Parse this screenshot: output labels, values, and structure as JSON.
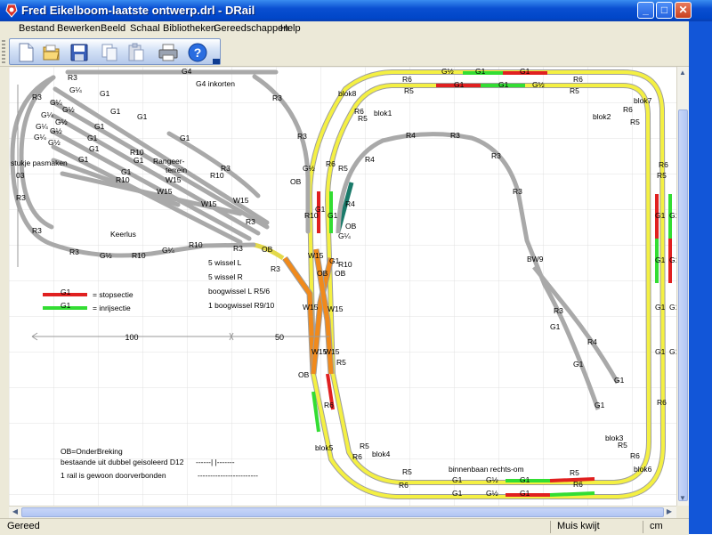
{
  "window": {
    "title": "Fred Eikelboom-laatste ontwerp.drl - DRail",
    "minimize": "_",
    "maximize": "□",
    "close": "✕"
  },
  "menu": [
    "Bestand",
    "Bewerken",
    "Beeld",
    "Schaal",
    "Bibliotheken",
    "Gereedschappen",
    "Help"
  ],
  "toolbar": {
    "icons": [
      "new-file-icon",
      "open-folder-icon",
      "save-disk-icon",
      "copy-icon",
      "paste-icon",
      "print-icon",
      "help-icon"
    ],
    "help_glyph": "?"
  },
  "status": {
    "left": "Gereed",
    "middle": "Muis kwijt",
    "right": "cm"
  },
  "colors": {
    "stop_section": "#e02020",
    "entry_section": "#33dd33",
    "rail_gray": "#b8b8b8",
    "rail_yellow": "#f4f043",
    "rail_orange": "#f08a1c",
    "rail_teal": "#1a7a6a"
  },
  "drawing": {
    "legend": {
      "stop_code": "G1",
      "stop_text": "= stopsectie",
      "entry_code": "G1",
      "entry_text": "= inrijsectie"
    },
    "switch_info": [
      "5 wissel L",
      "5 wissel R",
      "boogwissel L R5/6",
      "1 boogwissel R9/10"
    ],
    "ob_note": [
      "OB=OnderBreking",
      "bestaande uit dubbel geisoleerd D12",
      "1 rail is gewoon doorverbonden"
    ],
    "ob_symbol": "------| |-------",
    "ob_symbol_2": "------------------------",
    "ruler": {
      "label_100": "100",
      "label_50": "50"
    },
    "labels": {
      "g4": "G4",
      "g4_inkorten": "G4 inkorten",
      "stukje_pasmaken": "stukje pasmaken",
      "rangeer1": "Rangeer-",
      "rangeer2": "terrein",
      "keerlus": "Keerlus",
      "binnenbaan": "binnenbaan rechts-om",
      "blok1": "blok1",
      "blok2": "blok2",
      "blok3": "blok3",
      "blok4": "blok4",
      "blok5": "blok5",
      "blok6": "blok6",
      "blok7": "blok7",
      "blok8": "blok8",
      "ob": "OB",
      "bw9": "BW9",
      "w15": "W15",
      "r3": "R3",
      "r4": "R4",
      "r5": "R5",
      "r6": "R6",
      "r10": "R10",
      "g1": "G1",
      "g_half": "G½",
      "g_quarter": "G¼",
      "d03": "03"
    }
  }
}
